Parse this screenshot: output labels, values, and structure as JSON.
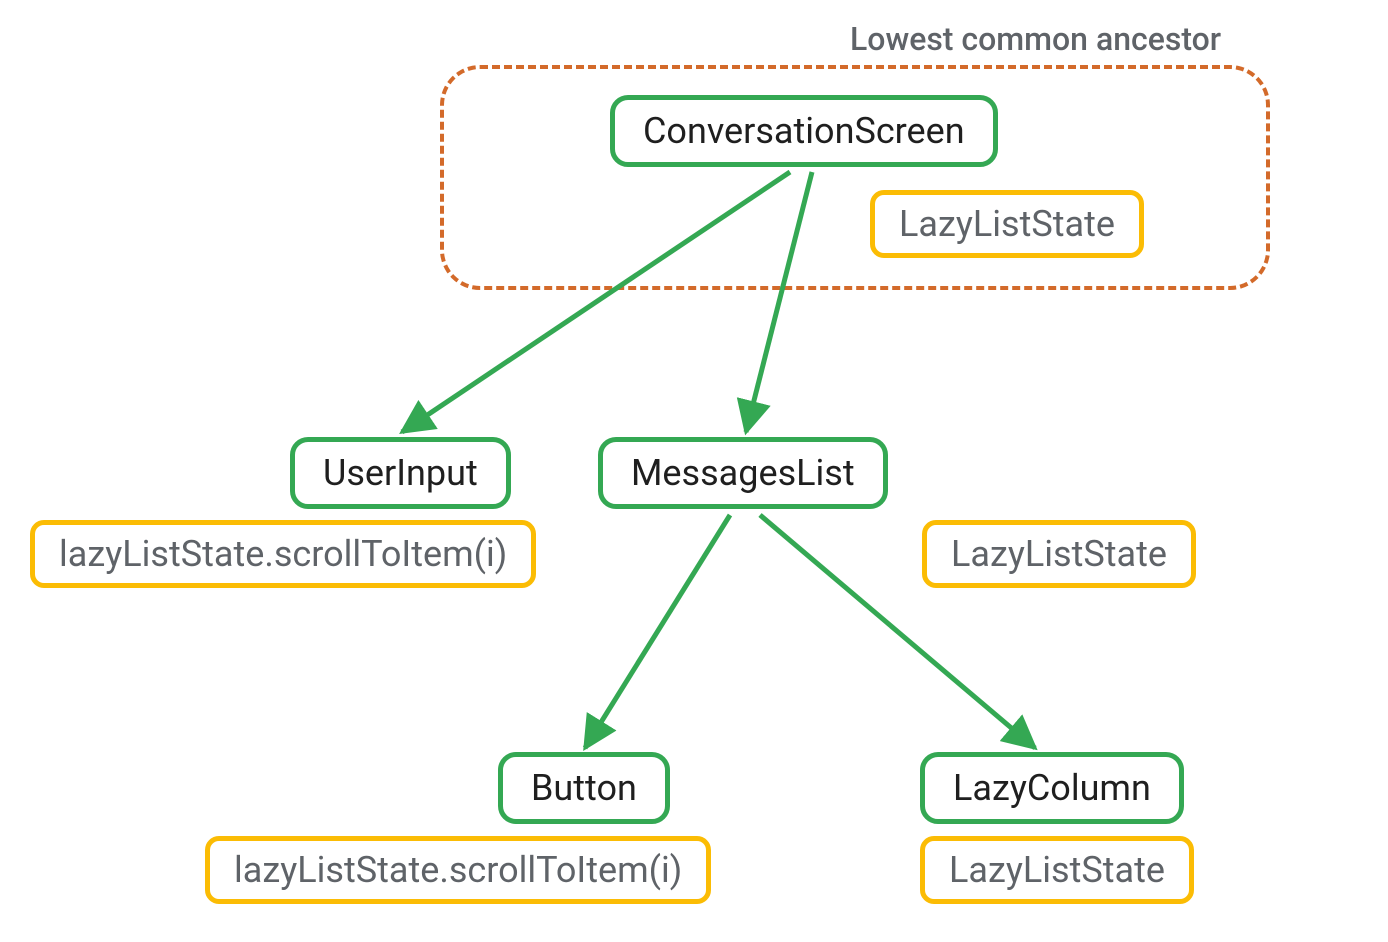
{
  "caption": "Lowest common ancestor",
  "nodes": {
    "conversationScreen": "ConversationScreen",
    "conversationScreen_state": "LazyListState",
    "userInput": "UserInput",
    "userInput_action": "lazyListState.scrollToItem(i)",
    "messagesList": "MessagesList",
    "messagesList_state": "LazyListState",
    "button": "Button",
    "button_action": "lazyListState.scrollToItem(i)",
    "lazyColumn": "LazyColumn",
    "lazyColumn_state": "LazyListState"
  },
  "colors": {
    "green": "#34a853",
    "yellow": "#fbbc04",
    "dashed": "#d36a2a",
    "textPrimary": "#1f1f1f",
    "textSecondary": "#5f6368"
  }
}
